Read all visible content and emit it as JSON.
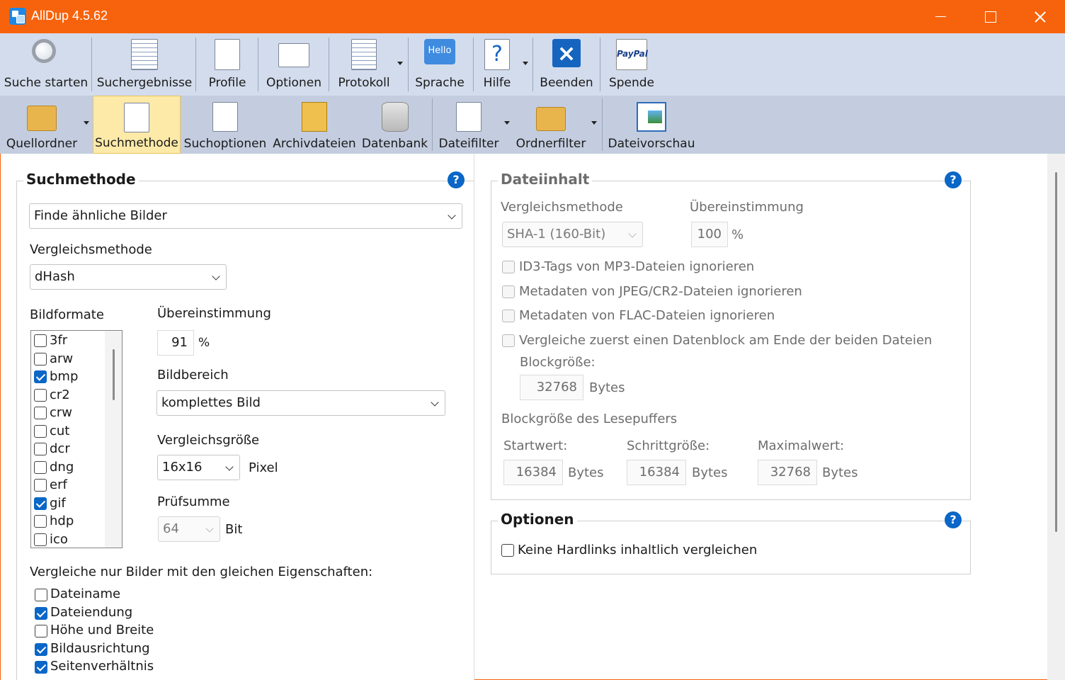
{
  "window": {
    "title": "AllDup 4.5.62"
  },
  "toolbar_main": [
    {
      "name": "search-start-button",
      "icon": "magnifier-icon",
      "label": "Suche starten"
    },
    {
      "name": "search-results-button",
      "icon": "results-doc-icon",
      "label": "Suchergebnisse"
    },
    {
      "name": "profiles-button",
      "icon": "profile-doc-icon",
      "label": "Profile"
    },
    {
      "name": "options-button",
      "icon": "options-gear-icon",
      "label": "Optionen"
    },
    {
      "name": "log-button",
      "icon": "log-doc-icon",
      "label": "Protokoll"
    },
    {
      "name": "language-button",
      "icon": "hello-bubble-icon",
      "label": "Sprache",
      "icon_text": "Hello"
    },
    {
      "name": "help-button",
      "icon": "help-doc-icon",
      "label": "Hilfe"
    },
    {
      "name": "exit-button",
      "icon": "exit-x-icon",
      "label": "Beenden"
    },
    {
      "name": "donate-button",
      "icon": "paypal-icon",
      "label": "Spende",
      "icon_text": "PayPal"
    }
  ],
  "toolbar_sub": [
    {
      "name": "source-folders-tab",
      "icon": "folder-search-icon",
      "label": "Quellordner"
    },
    {
      "name": "search-method-tab",
      "icon": "doc-search-icon",
      "label": "Suchmethode",
      "active": true
    },
    {
      "name": "search-options-tab",
      "icon": "doc-gear-icon",
      "label": "Suchoptionen"
    },
    {
      "name": "archive-files-tab",
      "icon": "archive-icon",
      "label": "Archivdateien"
    },
    {
      "name": "database-tab",
      "icon": "database-icon",
      "label": "Datenbank"
    },
    {
      "name": "file-filter-tab",
      "icon": "file-filter-icon",
      "label": "Dateifilter"
    },
    {
      "name": "folder-filter-tab",
      "icon": "folder-filter-icon",
      "label": "Ordnerfilter"
    },
    {
      "name": "file-preview-tab",
      "icon": "preview-icon",
      "label": "Dateivorschau"
    }
  ],
  "search_method": {
    "title": "Suchmethode",
    "method_value": "Finde ähnliche Bilder",
    "compare_label": "Vergleichsmethode",
    "compare_value": "dHash",
    "formats_label": "Bildformate",
    "formats": [
      {
        "label": "3fr",
        "checked": false
      },
      {
        "label": "arw",
        "checked": false
      },
      {
        "label": "bmp",
        "checked": true
      },
      {
        "label": "cr2",
        "checked": false
      },
      {
        "label": "crw",
        "checked": false
      },
      {
        "label": "cut",
        "checked": false
      },
      {
        "label": "dcr",
        "checked": false
      },
      {
        "label": "dng",
        "checked": false
      },
      {
        "label": "erf",
        "checked": false
      },
      {
        "label": "gif",
        "checked": true
      },
      {
        "label": "hdp",
        "checked": false
      },
      {
        "label": "ico",
        "checked": false
      }
    ],
    "match_label": "Übereinstimmung",
    "match_value": "91",
    "percent": "%",
    "area_label": "Bildbereich",
    "area_value": "komplettes Bild",
    "size_label": "Vergleichsgröße",
    "size_value": "16x16",
    "size_unit": "Pixel",
    "checksum_label": "Prüfsumme",
    "checksum_value": "64",
    "checksum_unit": "Bit",
    "same_props_label": "Vergleiche nur Bilder mit den gleichen Eigenschaften:",
    "same_props": [
      {
        "label": "Dateiname",
        "checked": false
      },
      {
        "label": "Dateiendung",
        "checked": true
      },
      {
        "label": "Höhe und Breite",
        "checked": false
      },
      {
        "label": "Bildausrichtung",
        "checked": true
      },
      {
        "label": "Seitenverhältnis",
        "checked": true
      }
    ]
  },
  "file_content": {
    "title": "Dateiinhalt",
    "compare_label": "Vergleichsmethode",
    "compare_value": "SHA-1 (160-Bit)",
    "match_label": "Übereinstimmung",
    "match_value": "100",
    "percent": "%",
    "checks": [
      "ID3-Tags von MP3-Dateien ignorieren",
      "Metadaten von JPEG/CR2-Dateien ignorieren",
      "Metadaten von FLAC-Dateien ignorieren",
      "Vergleiche zuerst einen Datenblock am Ende der beiden Dateien"
    ],
    "block_label": "Blockgröße:",
    "block_value": "32768",
    "bytes": "Bytes",
    "buffer_label": "Blockgröße des Lesepuffers",
    "start_label": "Startwert:",
    "start_value": "16384",
    "step_label": "Schrittgröße:",
    "step_value": "16384",
    "max_label": "Maximalwert:",
    "max_value": "32768"
  },
  "options": {
    "title": "Optionen",
    "hardlinks_label": "Keine Hardlinks inhaltlich vergleichen",
    "hardlinks_checked": false
  },
  "help_glyph": "?"
}
